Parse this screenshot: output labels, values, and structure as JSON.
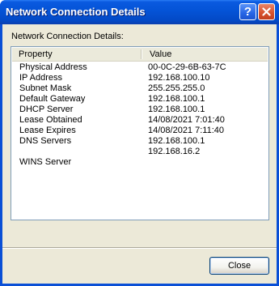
{
  "window": {
    "title": "Network Connection Details"
  },
  "titlebar": {
    "help_label": "?",
    "close_icon": "close-icon"
  },
  "group": {
    "label": "Network Connection Details:"
  },
  "table": {
    "columns": [
      "Property",
      "Value"
    ],
    "rows": [
      {
        "property": "Physical Address",
        "value": "00-0C-29-6B-63-7C"
      },
      {
        "property": "IP Address",
        "value": "192.168.100.10"
      },
      {
        "property": "Subnet Mask",
        "value": "255.255.255.0"
      },
      {
        "property": "Default Gateway",
        "value": "192.168.100.1"
      },
      {
        "property": "DHCP Server",
        "value": "192.168.100.1"
      },
      {
        "property": "Lease Obtained",
        "value": "14/08/2021 7:01:40"
      },
      {
        "property": "Lease Expires",
        "value": "14/08/2021 7:11:40"
      },
      {
        "property": "DNS Servers",
        "value": "192.168.100.1"
      },
      {
        "property": "",
        "value": "192.168.16.2"
      },
      {
        "property": "WINS Server",
        "value": ""
      }
    ]
  },
  "footer": {
    "close_label": "Close"
  }
}
